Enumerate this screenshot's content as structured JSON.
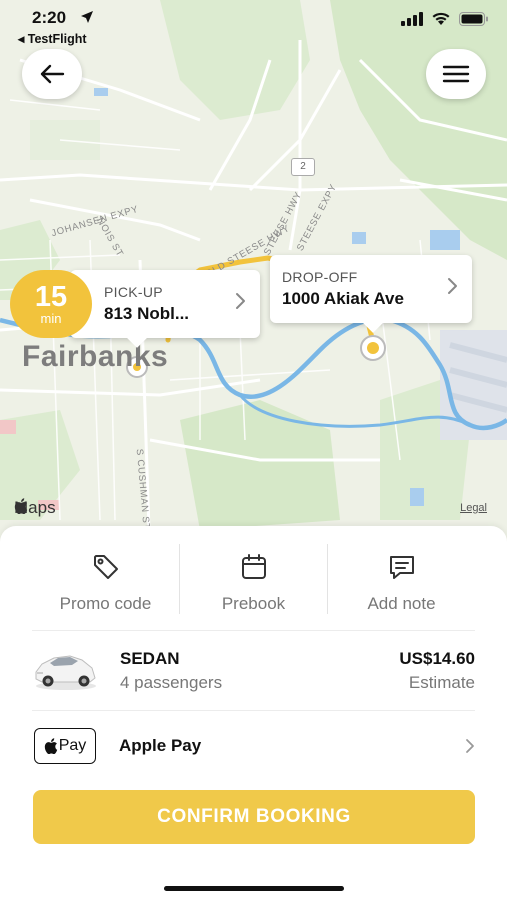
{
  "status_bar": {
    "time": "2:20",
    "back_app": "◂ TestFlight"
  },
  "map": {
    "city_label": "Fairbanks",
    "street_labels": {
      "johansen": "JOHANSEN EXPY",
      "nois": "NOIS ST",
      "old_steese": "OLD STEESE HWY",
      "steese_hwy": "STEESE HWY",
      "steese_expy": "STEESE EXPY",
      "cushman": "S CUSHMAN ST"
    },
    "route_shield": "2",
    "maps_brand": "Maps",
    "legal": "Legal",
    "colors": {
      "route": "#f2c33c",
      "water": "#7ab7e6",
      "park": "#d6e8c8"
    }
  },
  "eta": {
    "value": "15",
    "unit": "min"
  },
  "pickup": {
    "label": "PICK-UP",
    "address": "813 Nobl..."
  },
  "dropoff": {
    "label": "DROP-OFF",
    "address": "1000 Akiak Ave"
  },
  "actions": [
    {
      "label": "Promo code",
      "icon": "tag-icon"
    },
    {
      "label": "Prebook",
      "icon": "calendar-icon"
    },
    {
      "label": "Add note",
      "icon": "note-icon"
    }
  ],
  "vehicle": {
    "name": "SEDAN",
    "passengers": "4 passengers",
    "price": "US$14.60",
    "price_note": "Estimate"
  },
  "payment": {
    "badge_text": "Pay",
    "method": "Apple Pay"
  },
  "confirm_label": "CONFIRM BOOKING",
  "colors": {
    "accent": "#f0c94a"
  }
}
